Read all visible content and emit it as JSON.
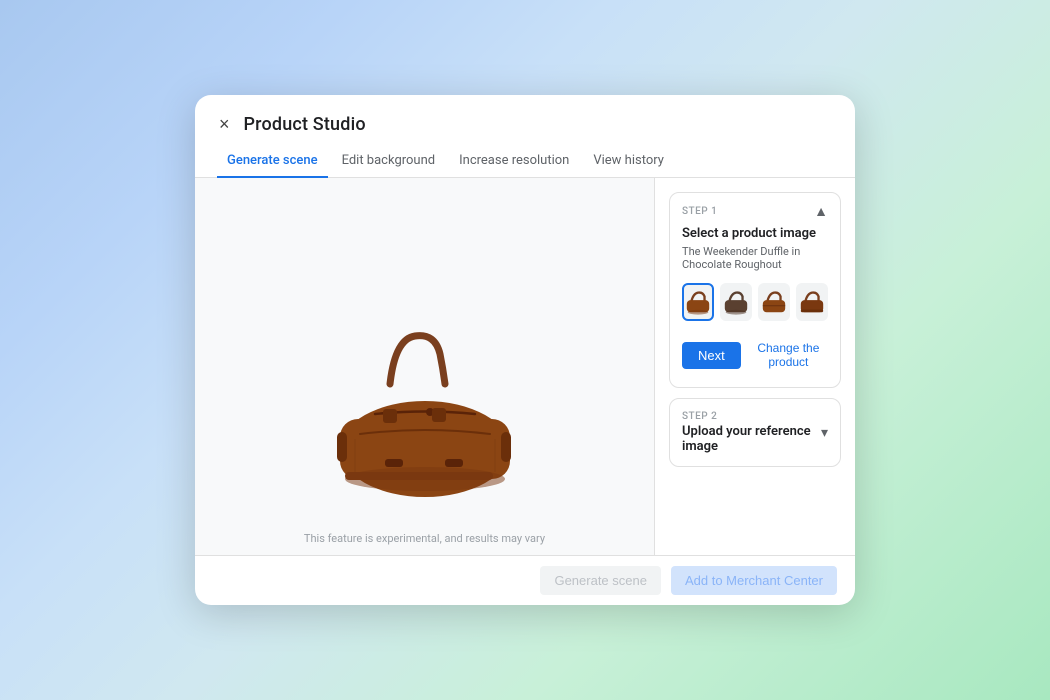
{
  "modal": {
    "title": "Product Studio",
    "close_label": "×"
  },
  "tabs": [
    {
      "label": "Generate scene",
      "active": true
    },
    {
      "label": "Edit background",
      "active": false
    },
    {
      "label": "Increase resolution",
      "active": false
    },
    {
      "label": "View history",
      "active": false
    }
  ],
  "step1": {
    "step_label": "STEP 1",
    "title": "Select a product image",
    "subtitle": "The Weekender Duffle in Chocolate Roughout",
    "chevron": "▲",
    "thumbnails": [
      {
        "id": "thumb1",
        "selected": true
      },
      {
        "id": "thumb2",
        "selected": false
      },
      {
        "id": "thumb3",
        "selected": false
      },
      {
        "id": "thumb4",
        "selected": false
      }
    ],
    "next_btn": "Next",
    "change_btn": "Change the product"
  },
  "step2": {
    "step_label": "STEP 2",
    "title": "Upload your reference image",
    "chevron": "▾"
  },
  "preview": {
    "disclaimer": "This feature is experimental, and results may vary"
  },
  "footer": {
    "generate_btn": "Generate scene",
    "add_btn": "Add to Merchant Center"
  }
}
